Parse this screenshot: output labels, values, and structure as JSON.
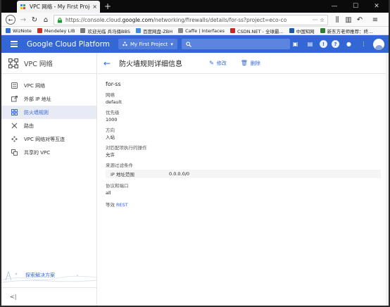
{
  "browser": {
    "tab_title": "VPC 网络 - My First Project",
    "tab_close": "×",
    "new_tab": "+",
    "url_prefix": "https://console.cloud.",
    "url_domain": "google.com",
    "url_rest": "/networking/firewalls/details/for-ss?project=eco-co",
    "url_tools": "···  ☆",
    "win_min": "—",
    "win_max": "☐",
    "win_close": "✕"
  },
  "bookmarks": [
    {
      "label": "WizNote",
      "color": "#2f6fd6"
    },
    {
      "label": "Mendeley LIB",
      "color": "#c9302c"
    },
    {
      "label": "欢迎光临 兵马俑BBS",
      "color": "#7a7a7a"
    },
    {
      "label": "百度网盘-ZBH",
      "color": "#3d8fe0"
    },
    {
      "label": "Caffe | Interfaces",
      "color": "#8b8b8b"
    },
    {
      "label": "CSDN.NET - 全球最...",
      "color": "#c62828"
    },
    {
      "label": "中国知网",
      "color": "#1e5aa8"
    },
    {
      "label": "新东方老师推荐：终...",
      "color": "#2e7d32"
    }
  ],
  "header": {
    "brand": "Google Cloud Platform",
    "project": "My First Project",
    "project_caret": "▾",
    "search_icon": "🔍"
  },
  "sidebar": {
    "title": "VPC 网络",
    "items": [
      {
        "label": "VPC 网络",
        "icon": "vpc-network-icon"
      },
      {
        "label": "外部 IP 地址",
        "icon": "external-ip-icon"
      },
      {
        "label": "防火墙规则",
        "icon": "firewall-icon",
        "active": true
      },
      {
        "label": "路由",
        "icon": "routes-icon"
      },
      {
        "label": "VPC 网络对等互连",
        "icon": "peering-icon"
      },
      {
        "label": "共享的 VPC",
        "icon": "shared-vpc-icon"
      }
    ],
    "footer_link": "探索解决方案",
    "collapse": "<|"
  },
  "main": {
    "back": "←",
    "title": "防火墙规则详细信息",
    "edit": "修改",
    "delete": "删除",
    "rule_name": "for-ss",
    "fields": [
      {
        "label": "网络",
        "value": "default"
      },
      {
        "label": "优先级",
        "value": "1000"
      },
      {
        "label": "方向",
        "value": "入站"
      },
      {
        "label": "对匹配项执行的操作",
        "value": "允许"
      }
    ],
    "source_filter_label": "来源过滤条件",
    "source_filter": {
      "key": "IP 地址范围",
      "value": "0.0.0.0/0"
    },
    "protocols_label": "协议和端口",
    "protocols_value": "all",
    "equiv_prefix": "等效",
    "equiv_link": "REST"
  }
}
